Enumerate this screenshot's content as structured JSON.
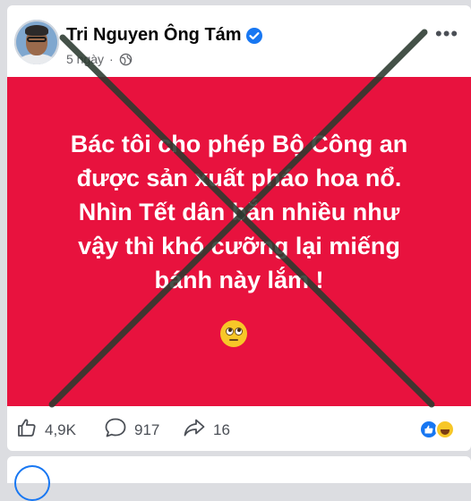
{
  "post": {
    "author": "Tri Nguyen Ông Tám",
    "time": "5 ngày",
    "text_lines": [
      "Bác tôi cho phép Bộ Công an",
      "được sản xuất pháo hoa nổ.",
      "Nhìn Tết dân bắn nhiều như",
      "vậy thì khó cưỡng lại miếng",
      "bánh này lắm !"
    ],
    "background_color": "#e8123e"
  },
  "actions": {
    "likes": "4,9K",
    "comments": "917",
    "shares": "16"
  },
  "icons": {
    "verified": "verified-badge-icon",
    "privacy": "globe-icon",
    "more": "more-options-icon",
    "like": "thumbs-up-icon",
    "comment": "comment-bubble-icon",
    "share": "share-arrow-icon",
    "emoji": "eye-roll-emoji"
  },
  "overlay": {
    "type": "cross-out",
    "color": "#2b3a2f"
  }
}
